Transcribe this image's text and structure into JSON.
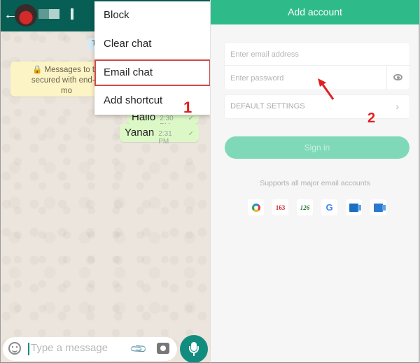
{
  "left_panel": {
    "header": {
      "back_icon": "arrow-left-icon",
      "contact_name": "(blurred)"
    },
    "date_chip": "T",
    "encryption_notice": "🔒 Messages to this chat are secured with end-to-end encryption. Tap for more info.",
    "encryption_notice_visible": "🔒 Messages to thi... secured with end-to... mo...",
    "messages": [
      {
        "text": "Hallo",
        "time": "2:30 PM",
        "status": "✓"
      },
      {
        "text": "Yanan",
        "time": "2:31 PM",
        "status": "✓"
      }
    ],
    "overflow_menu": {
      "items": [
        {
          "label": "Block"
        },
        {
          "label": "Clear chat"
        },
        {
          "label": "Email chat",
          "highlighted": true
        },
        {
          "label": "Add shortcut"
        }
      ]
    },
    "annotation_step": "1",
    "input_bar": {
      "placeholder": "Type a message",
      "value": ""
    }
  },
  "right_panel": {
    "header_title": "Add account",
    "email_field": {
      "placeholder": "Enter email address",
      "value": ""
    },
    "password_field": {
      "placeholder": "Enter password",
      "value": ""
    },
    "default_settings_label": "DEFAULT SETTINGS",
    "signin_label": "Sign in",
    "supports_text": "Supports all major email accounts",
    "providers": [
      {
        "name": "sina",
        "label": ""
      },
      {
        "name": "163",
        "label": "163",
        "color": "#c8262c"
      },
      {
        "name": "126",
        "label": "126",
        "color": "#2a7a3a"
      },
      {
        "name": "google",
        "label": "G"
      },
      {
        "name": "outlook",
        "label": ""
      },
      {
        "name": "exchange",
        "label": ""
      }
    ],
    "annotation_step": "2"
  },
  "colors": {
    "whatsapp_header": "#075e54",
    "whatsapp_accent": "#128c7e",
    "bubble_out": "#dcf8c6",
    "mail_header": "#2fbb89",
    "signin_disabled": "#7fd9b8",
    "annotation_red": "#e02020"
  }
}
